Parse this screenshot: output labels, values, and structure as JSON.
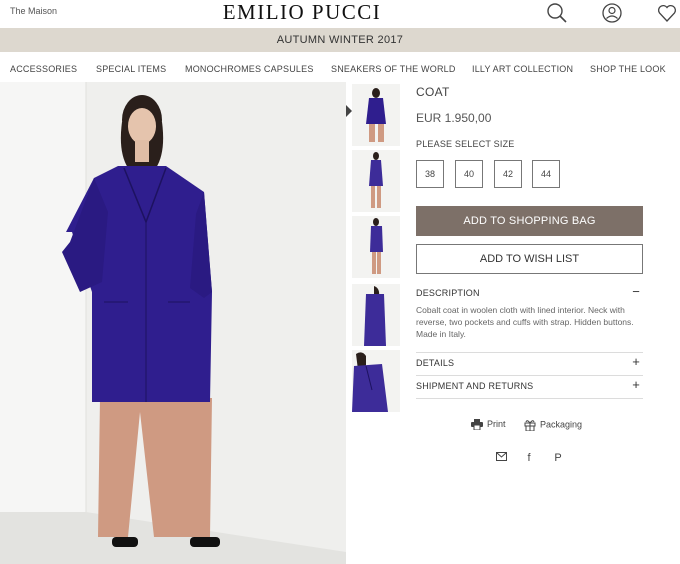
{
  "header": {
    "maison_label": "The Maison",
    "brand": "EMILIO PUCCI",
    "icons": [
      "search-icon",
      "account-icon",
      "wishlist-heart-icon"
    ]
  },
  "banner": {
    "season": "AUTUMN WINTER 2017"
  },
  "nav": {
    "items": [
      "ACCESSORIES",
      "SPECIAL ITEMS",
      "MONOCHROMES CAPSULES",
      "SNEAKERS OF THE WORLD",
      "ILLY ART COLLECTION",
      "SHOP THE LOOK"
    ]
  },
  "product": {
    "title": "COAT",
    "price": "EUR 1.950,00",
    "size_label": "PLEASE SELECT SIZE",
    "sizes": [
      "38",
      "40",
      "42",
      "44"
    ],
    "add_to_bag": "ADD TO SHOPPING BAG",
    "add_to_wishlist": "ADD TO WISH LIST",
    "coat_color": "#2f1e8e",
    "trouser_color": "#cf9a82"
  },
  "accordion": {
    "description": {
      "title": "DESCRIPTION",
      "sign": "−",
      "text": "Cobalt coat in woolen cloth with lined interior. Neck with reverse, two pockets and cuffs with strap. Hidden buttons. Made in Italy."
    },
    "details": {
      "title": "DETAILS",
      "sign": "+"
    },
    "shipment": {
      "title": "SHIPMENT AND RETURNS",
      "sign": "+"
    }
  },
  "tools": {
    "print": "Print",
    "packaging": "Packaging"
  },
  "share": {
    "icons": [
      "email-icon",
      "facebook-icon",
      "pinterest-icon"
    ],
    "facebook_glyph": "f",
    "pinterest_glyph": "P"
  },
  "thumbnails": [
    "front-view",
    "full-length-view",
    "side-view",
    "back-view",
    "detail-view"
  ]
}
